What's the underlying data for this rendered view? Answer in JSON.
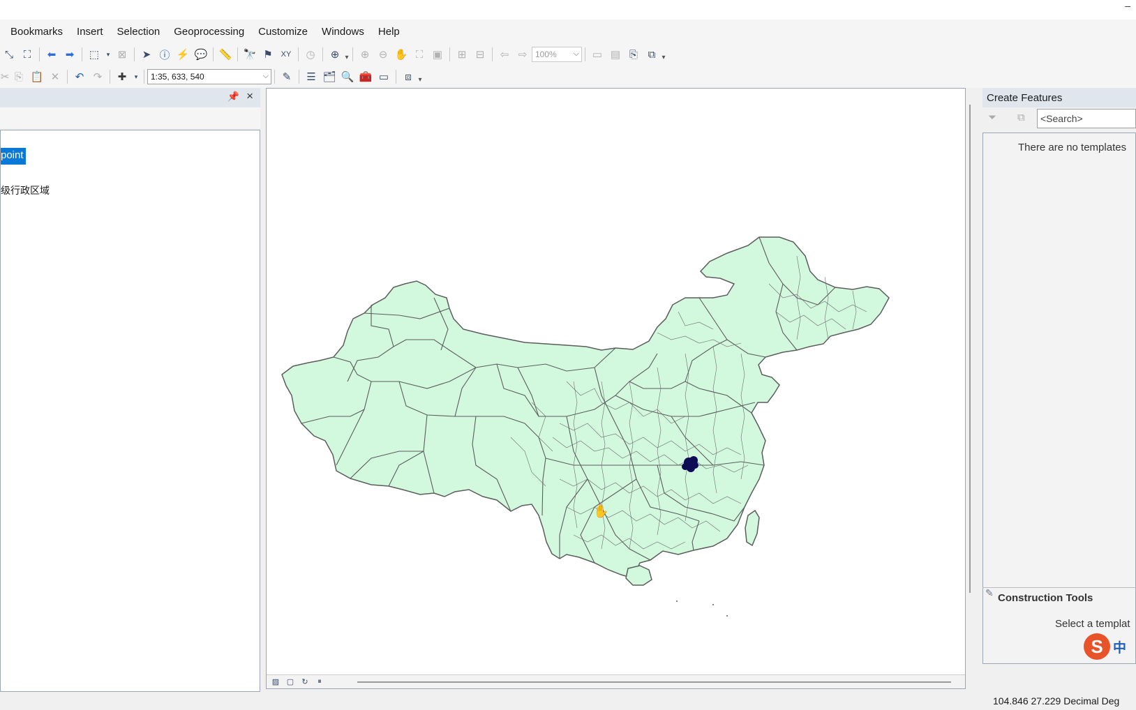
{
  "titlebar": {
    "minimize_glyph": "–"
  },
  "menu": [
    "Bookmarks",
    "Insert",
    "Selection",
    "Geoprocessing",
    "Customize",
    "Windows",
    "Help"
  ],
  "toolbar": {
    "zoom_percent": "100%",
    "map_scale": "1:35, 633, 540"
  },
  "toc": {
    "selected_layer": "point",
    "layer_label": "级行政区域"
  },
  "create_features": {
    "title": "Create Features",
    "search_placeholder": "<Search>",
    "empty_text": "There are no templates",
    "construction_title": "Construction Tools",
    "construction_hint": "Select a templat",
    "ime_logo": "S",
    "ime_lang": "中"
  },
  "status": {
    "coordinates": "104.846  27.229 Decimal Deg"
  },
  "colors": {
    "land_fill": "#d2f9de",
    "boundary": "#5c5c5c",
    "selection_marker": "#0d0d55",
    "accent": "#0a78d7"
  }
}
